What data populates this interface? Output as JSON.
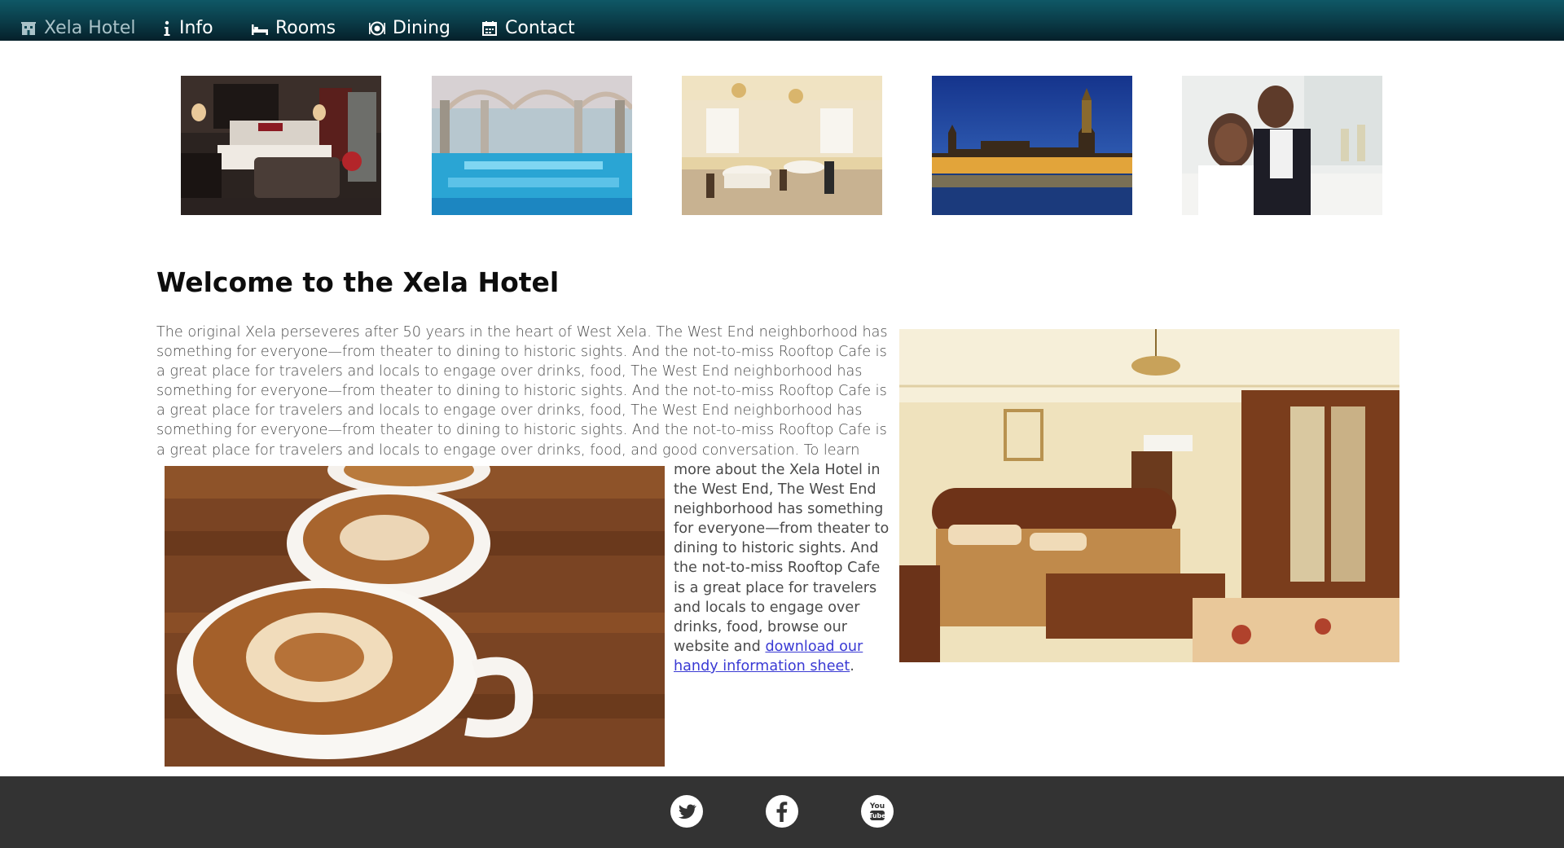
{
  "nav": {
    "brand": {
      "label": "Xela Hotel",
      "icon": "building-icon"
    },
    "items": [
      {
        "label": "Info",
        "icon": "info-icon"
      },
      {
        "label": "Rooms",
        "icon": "bed-icon"
      },
      {
        "label": "Dining",
        "icon": "dining-icon"
      },
      {
        "label": "Contact",
        "icon": "calendar-icon"
      }
    ]
  },
  "gallery": [
    {
      "subject": "hotel-bedroom"
    },
    {
      "subject": "indoor-pool"
    },
    {
      "subject": "banquet-hall"
    },
    {
      "subject": "city-skyline-at-night"
    },
    {
      "subject": "wedding-couple"
    }
  ],
  "main": {
    "title": "Welcome to the Xela Hotel",
    "intro": "The original Xela perseveres after 50 years in the heart of West Xela. The West End neighborhood has something for everyone—from theater to dining to historic sights. And the not-to-miss Rooftop Cafe is a great place for travelers and locals to engage over drinks, food, The West End neighborhood has something for everyone—from theater to dining to historic sights. And the not-to-miss Rooftop Cafe is a great place for travelers and locals to engage over drinks, food, The West End neighborhood has something for everyone—from theater to dining to historic sights. And the not-to-miss Rooftop Cafe is a great place for travelers and locals to engage over drinks, food, and good conversation.  To learn",
    "continued": "more about the Xela Hotel in the West End, The West End neighborhood has something for everyone—from theater to dining to historic sights. And the not-to-miss Rooftop Cafe is a great place for travelers and locals to engage over drinks, food, browse our website and ",
    "link_text": "download our handy information sheet",
    "trailing": "."
  },
  "footer": {
    "social": [
      {
        "icon": "twitter-icon"
      },
      {
        "icon": "facebook-icon"
      },
      {
        "icon": "youtube-icon",
        "text": "You Tube"
      }
    ]
  },
  "colors": {
    "nav_top": "#0f5866",
    "nav_bottom": "#05202a",
    "footer_bg": "#333333",
    "link": "#3a3ad4",
    "body_text": "#4a4a4a"
  }
}
